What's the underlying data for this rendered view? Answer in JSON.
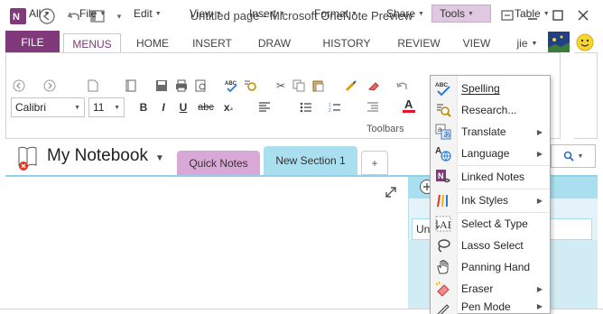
{
  "window": {
    "title": "Untitled page - Microsoft OneNote Preview",
    "user": "jie",
    "help_label": "?",
    "app_icon": "onenote-icon"
  },
  "ribbon_tabs": [
    "FILE",
    "MENUS",
    "HOME",
    "INSERT",
    "DRAW",
    "HISTORY",
    "REVIEW",
    "VIEW"
  ],
  "menus_bar": [
    "All",
    "File",
    "Edit",
    "View",
    "Insert",
    "Format",
    "Share",
    "Tools",
    "Table"
  ],
  "toolbar": {
    "font": "Calibri",
    "size": "11",
    "group_label": "Toolbars"
  },
  "notebook": {
    "name": "My Notebook",
    "sections": [
      "Quick Notes",
      "New Section 1"
    ],
    "add_section": "+",
    "page_preview": "Un"
  },
  "tools_menu": [
    {
      "label": "Spelling",
      "icon": "spelling-icon",
      "submenu": false
    },
    {
      "label": "Research...",
      "icon": "research-icon",
      "submenu": false
    },
    {
      "label": "Translate",
      "icon": "translate-icon",
      "submenu": true
    },
    {
      "label": "Language",
      "icon": "language-icon",
      "submenu": true
    },
    {
      "label": "Linked Notes",
      "icon": "linked-notes-icon",
      "submenu": false
    },
    {
      "label": "Ink Styles",
      "icon": "ink-styles-icon",
      "submenu": true
    },
    {
      "label": "Select & Type",
      "icon": "select-type-icon",
      "submenu": false
    },
    {
      "label": "Lasso Select",
      "icon": "lasso-icon",
      "submenu": false
    },
    {
      "label": "Panning Hand",
      "icon": "hand-icon",
      "submenu": false
    },
    {
      "label": "Eraser",
      "icon": "eraser-icon",
      "submenu": true
    },
    {
      "label": "Pen Mode",
      "icon": "pen-mode-icon",
      "submenu": true
    }
  ],
  "colors": {
    "accent": "#80397b",
    "menu_highlight": "#e1c8e1",
    "quick_notes_tab": "#d9a8d6",
    "section_tab": "#a9dfee",
    "page_border": "#8fd1e6"
  }
}
